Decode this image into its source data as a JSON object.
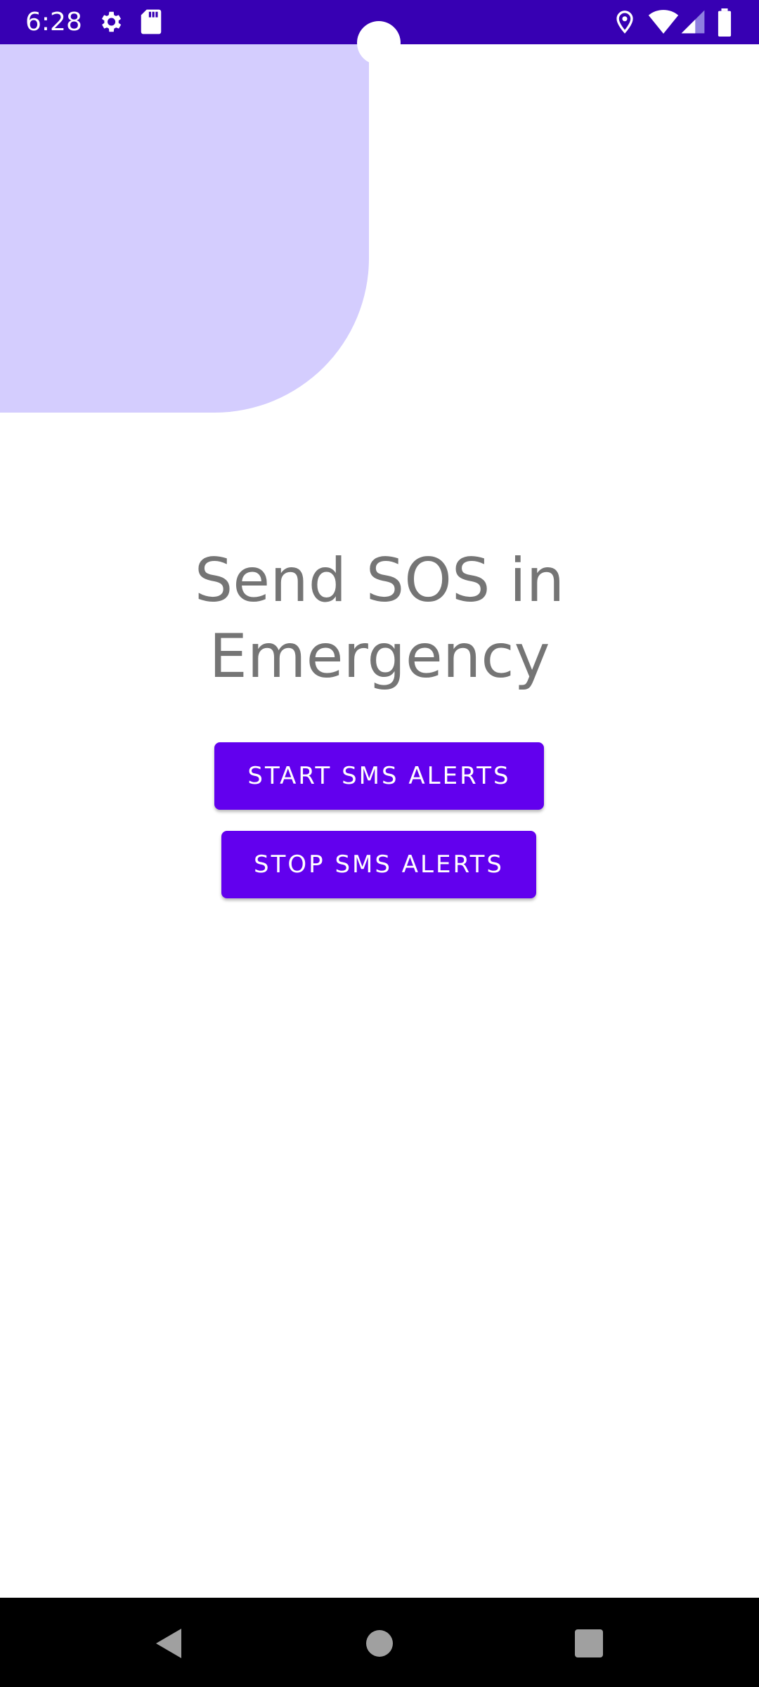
{
  "status_bar": {
    "time": "6:28",
    "background_color": "#3700b3",
    "icons_left": [
      "gear-icon",
      "sd-card-icon"
    ],
    "icons_right": [
      "location-icon",
      "wifi-icon",
      "signal-icon",
      "battery-icon"
    ]
  },
  "main": {
    "title": "Send SOS in\nEmergency",
    "start_button_label": "START SMS ALERTS",
    "stop_button_label": "STOP SMS ALERTS"
  },
  "theme": {
    "primary": "#6200ee",
    "primary_dark": "#3700b3",
    "decor": "#d4cdfe",
    "title_text": "#757575"
  },
  "nav_bar": {
    "buttons": [
      "back-icon",
      "home-icon",
      "recents-icon"
    ]
  }
}
